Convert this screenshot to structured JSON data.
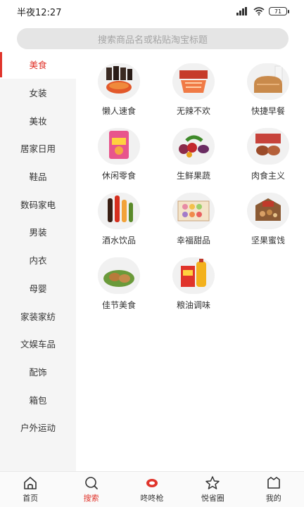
{
  "status_bar": {
    "time": "半夜12:27",
    "battery": "71"
  },
  "search": {
    "placeholder": "搜索商品名或粘贴淘宝标题"
  },
  "sidebar": {
    "items": [
      {
        "label": "美食"
      },
      {
        "label": "女装"
      },
      {
        "label": "美妆"
      },
      {
        "label": "居家日用"
      },
      {
        "label": "鞋品"
      },
      {
        "label": "数码家电"
      },
      {
        "label": "男装"
      },
      {
        "label": "内衣"
      },
      {
        "label": "母婴"
      },
      {
        "label": "家装家纺"
      },
      {
        "label": "文娱车品"
      },
      {
        "label": "配饰"
      },
      {
        "label": "箱包"
      },
      {
        "label": "户外运动"
      }
    ],
    "active_index": 0
  },
  "categories": [
    {
      "label": "懒人速食",
      "icon": "instant-food-icon"
    },
    {
      "label": "无辣不欢",
      "icon": "spicy-snack-icon"
    },
    {
      "label": "快捷早餐",
      "icon": "breakfast-icon"
    },
    {
      "label": "休闲零食",
      "icon": "snack-bag-icon"
    },
    {
      "label": "生鲜果蔬",
      "icon": "fruit-vegetable-icon"
    },
    {
      "label": "肉食主义",
      "icon": "meat-icon"
    },
    {
      "label": "酒水饮品",
      "icon": "drinks-icon"
    },
    {
      "label": "幸福甜品",
      "icon": "dessert-icon"
    },
    {
      "label": "坚果蜜饯",
      "icon": "nuts-icon"
    },
    {
      "label": "佳节美食",
      "icon": "festival-food-icon"
    },
    {
      "label": "粮油调味",
      "icon": "grain-oil-icon"
    }
  ],
  "bottom_nav": [
    {
      "label": "首页",
      "icon": "home-icon"
    },
    {
      "label": "搜索",
      "icon": "search-icon"
    },
    {
      "label": "咚咚枪",
      "icon": "dongdong-icon"
    },
    {
      "label": "悦省圈",
      "icon": "star-icon"
    },
    {
      "label": "我的",
      "icon": "profile-icon"
    }
  ],
  "colors": {
    "accent": "#e0342b",
    "sidebar_bg": "#f5f5f5",
    "search_bg": "#e5e5e5"
  }
}
